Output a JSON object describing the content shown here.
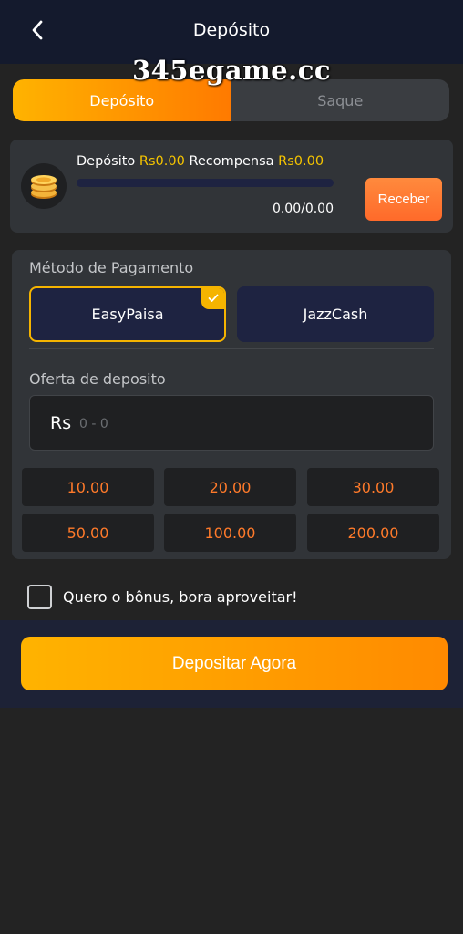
{
  "header": {
    "title": "Depósito"
  },
  "watermark": "345egame.cc",
  "tabs": [
    {
      "label": "Depósito",
      "active": true
    },
    {
      "label": "Saque",
      "active": false
    }
  ],
  "reward": {
    "deposit_label": "Depósito",
    "deposit_value": "Rs0.00",
    "reward_label": "Recompensa",
    "reward_value": "Rs0.00",
    "progress_text": "0.00/0.00",
    "progress_fraction": 0,
    "claim_label": "Receber"
  },
  "payment": {
    "label": "Método de Pagamento",
    "methods": [
      {
        "label": "EasyPaisa",
        "selected": true
      },
      {
        "label": "JazzCash",
        "selected": false
      }
    ]
  },
  "offer": {
    "label": "Oferta de deposito",
    "currency": "Rs",
    "placeholder": "0 - 0",
    "value": ""
  },
  "presets": [
    "10.00",
    "20.00",
    "30.00",
    "50.00",
    "100.00",
    "200.00"
  ],
  "bonus": {
    "label": "Quero o bônus, bora aproveitar!",
    "checked": false
  },
  "submit_label": "Depositar Agora",
  "colors": {
    "accent_orange": "#ff8a00",
    "accent_gold": "#f5c400",
    "preset_text": "#ff7a2a",
    "method_bg": "#1e2341"
  }
}
